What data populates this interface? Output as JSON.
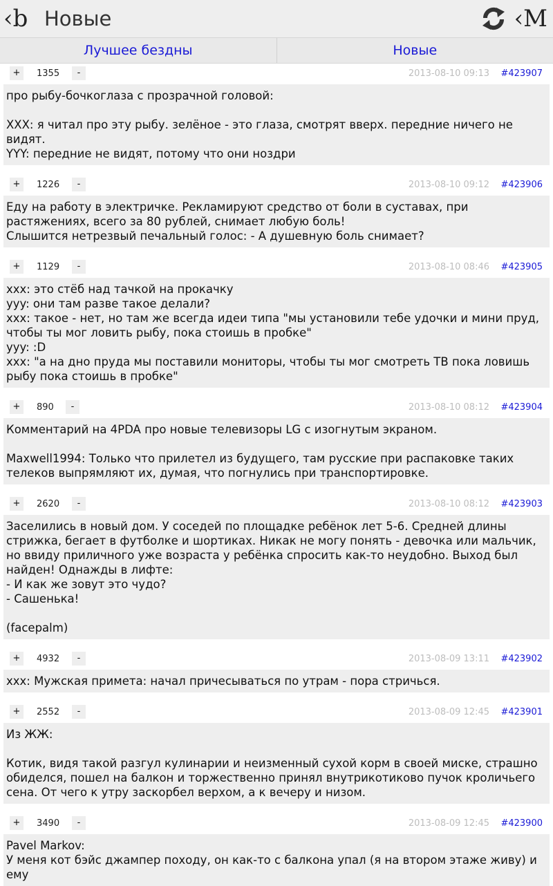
{
  "header": {
    "logo": "‹b",
    "title": "Новые",
    "refresh_icon": "refresh-icon",
    "menu_logo": "‹M"
  },
  "tabs": [
    {
      "label": "Лучшее бездны"
    },
    {
      "label": "Новые"
    }
  ],
  "vote_labels": {
    "plus": "+",
    "minus": "-"
  },
  "posts": [
    {
      "rating": "1355",
      "date": "2013-08-10 09:13",
      "id": "#423907",
      "text": "про рыбу-бочкоглаза с прозрачной головой:\n\nXXX: я читал про эту рыбу. зелёное - это глаза, смотрят вверх. передние ничего не видят.\nYYY: передние не видят, потому что они ноздри"
    },
    {
      "rating": "1226",
      "date": "2013-08-10 09:12",
      "id": "#423906",
      "text": "Еду на работу в электричке. Рекламируют средство от боли в суставах, при растяжениях, всего за 80 рублей, снимает любую боль!\nСлышится нетрезвый печальный голос: - А душевную боль снимает?"
    },
    {
      "rating": "1129",
      "date": "2013-08-10 08:46",
      "id": "#423905",
      "text": "xxx: это стёб над тачкой на прокачку\nyyy: они там разве такое делали?\nxxx: такое - нет, но там же всегда идеи типа \"мы установили тебе удочки и мини пруд, чтобы ты мог ловить рыбу, пока стоишь в пробке\"\nyyy: :D\nxxx: \"а на дно пруда мы поставили мониторы, чтобы ты мог смотреть ТВ пока ловишь рыбу пока стоишь в пробке\""
    },
    {
      "rating": "890",
      "date": "2013-08-10 08:12",
      "id": "#423904",
      "text": "Комментарий на 4PDA про новые телевизоры LG с изогнутым экраном.\n\nMaxwell1994: Только что прилетел из будущего, там русские при распаковке таких телеков выпрямляют их, думая, что погнулись при транспортировке."
    },
    {
      "rating": "2620",
      "date": "2013-08-10 08:12",
      "id": "#423903",
      "text": "Заселились в новый дом. У соседей по площадке ребёнок лет 5-6. Средней длины стрижка, бегает в футболке и шортиках. Никак не могу понять - девочка или мальчик, но ввиду приличного уже возраста у ребёнка спросить как-то неудобно. Выход был найден! Однажды в лифте:\n- И как же зовут это чудо?\n- Сашенька!\n\n(facepalm)"
    },
    {
      "rating": "4932",
      "date": "2013-08-09 13:11",
      "id": "#423902",
      "text": "xxx: Мужская примета: начал причесываться по утрам - пора стричься."
    },
    {
      "rating": "2552",
      "date": "2013-08-09 12:45",
      "id": "#423901",
      "text": "Из ЖЖ:\n\nКотик, видя такой разгул кулинарии и неизменный сухой корм в своей миске, страшно обиделся, пошел на балкон и торжественно принял внутрикотиково пучок кроличьего сена. От чего к утру заскорбел верхом, а к вечеру и низом."
    },
    {
      "rating": "3490",
      "date": "2013-08-09 12:45",
      "id": "#423900",
      "text": "Pavel Markov:\nУ меня кот бэйс джампер походу, он как-то с балкона упал (я на втором этаже живу) и ему"
    }
  ]
}
